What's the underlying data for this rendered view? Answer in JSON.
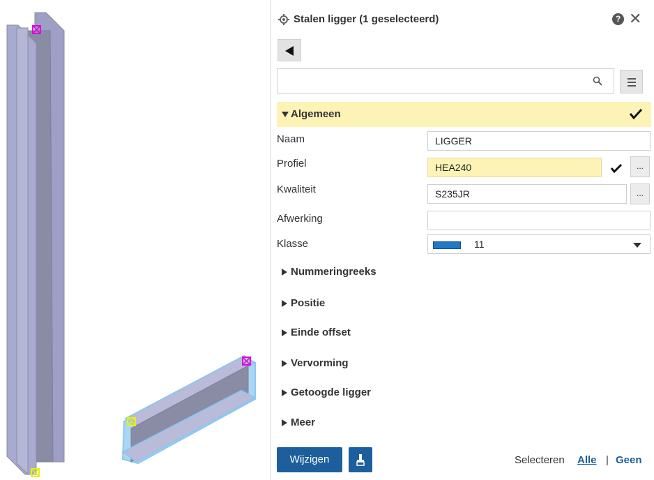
{
  "panel": {
    "title": "Stalen ligger (1 geselecteerd)",
    "help_glyph": "?",
    "close_glyph": "✕",
    "search": {
      "value": "",
      "placeholder": ""
    }
  },
  "sections": {
    "general": {
      "label": "Algemeen",
      "open": true
    },
    "collapsed": [
      {
        "label": "Nummeringreeks"
      },
      {
        "label": "Positie"
      },
      {
        "label": "Einde offset"
      },
      {
        "label": "Vervorming"
      },
      {
        "label": "Getoogde ligger"
      },
      {
        "label": "Meer"
      }
    ]
  },
  "properties": {
    "naam": {
      "label": "Naam",
      "value": "LIGGER"
    },
    "profiel": {
      "label": "Profiel",
      "value": "HEA240"
    },
    "kwaliteit": {
      "label": "Kwaliteit",
      "value": "S235JR"
    },
    "afwerking": {
      "label": "Afwerking",
      "value": ""
    },
    "klasse": {
      "label": "Klasse",
      "value": "11",
      "swatch_color": "#1f78c8"
    }
  },
  "buttons": {
    "ellipsis": "..."
  },
  "footer": {
    "modify_label": "Wijzigen",
    "select_label": "Selecteren",
    "all_label": "Alle",
    "separator": "|",
    "none_label": "Geen"
  },
  "colors": {
    "accent": "#1d5f9c",
    "highlight": "#fdf3b6",
    "beam_face": "#a8abcf",
    "beam_dark": "#8a8ca6",
    "beam_edge": "#a9d6f5",
    "handle_magenta": "#e000e0",
    "handle_yellow": "#e8f000"
  },
  "icons": {
    "title": "gear-icon",
    "help": "help-icon",
    "close": "close-icon",
    "back": "back-arrow-icon",
    "search": "search-icon",
    "menu": "hamburger-icon",
    "check": "checkmark-icon",
    "brush": "paintbrush-icon"
  }
}
